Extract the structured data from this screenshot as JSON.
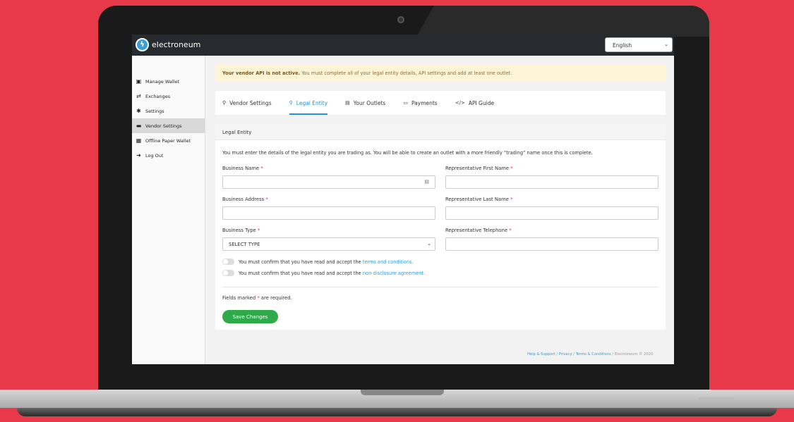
{
  "app": {
    "logo_text": "electroneum",
    "language": "English"
  },
  "sidebar": {
    "items": [
      {
        "label": "Manage Wallet",
        "icon": "wallet-icon"
      },
      {
        "label": "Exchanges",
        "icon": "exchange-arrows-icon"
      },
      {
        "label": "Settings",
        "icon": "gear-icon"
      },
      {
        "label": "Vendor Settings",
        "icon": "cart-icon"
      },
      {
        "label": "Offline Paper Wallet",
        "icon": "qr-code-icon"
      },
      {
        "label": "Log Out",
        "icon": "logout-icon"
      }
    ]
  },
  "alert": {
    "bold": "Your vendor API is not active.",
    "text": "You must complete all of your legal entity details, API settings and add at least one outlet."
  },
  "tabs": [
    {
      "label": "Vendor Settings",
      "icon": "wrench-icon"
    },
    {
      "label": "Legal Entity",
      "icon": "wrench-icon"
    },
    {
      "label": "Your Outlets",
      "icon": "store-icon"
    },
    {
      "label": "Payments",
      "icon": "card-icon"
    },
    {
      "label": "API Guide",
      "icon": "code-icon"
    }
  ],
  "active_tab": "Legal Entity",
  "form": {
    "heading": "Legal Entity",
    "intro": "You must enter the details of the legal entity you are trading as. You will be able to create an outlet with a more friendly “trading” name once this is complete.",
    "business_name": {
      "label": "Business Name",
      "value": ""
    },
    "business_address": {
      "label": "Business Address",
      "value": ""
    },
    "business_type": {
      "label": "Business Type",
      "value": "SELECT TYPE"
    },
    "rep_first": {
      "label": "Representative First Name",
      "value": ""
    },
    "rep_last": {
      "label": "Representative Last Name",
      "value": ""
    },
    "rep_phone": {
      "label": "Representative Telephone",
      "value": ""
    },
    "required_mark": "*",
    "terms_text": "You must confirm that you have read and accept the",
    "terms_link": "terms and conditions.",
    "nda_text": "You must confirm that you have read and accept the",
    "nda_link": "non-disclosure agreement.",
    "note_before": "Fields marked",
    "note_after": "are required.",
    "save_label": "Save Changes"
  },
  "footer": {
    "help": "Help & Support",
    "privacy": "Privacy",
    "terms": "Terms & Conditions",
    "copyright": "Electroneum © 2020",
    "sep": "/"
  },
  "colors": {
    "background": "#e8394a",
    "accent": "#2a8fd6",
    "save": "#2eaa4b",
    "topbar": "#272a2e"
  }
}
